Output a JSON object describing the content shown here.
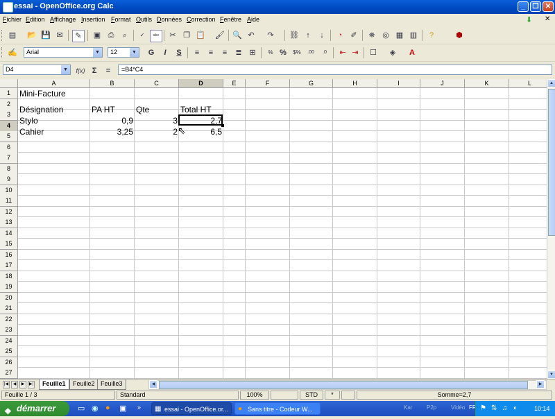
{
  "window": {
    "title": "essai - OpenOffice.org Calc"
  },
  "menu": [
    "Fichier",
    "Edition",
    "Affichage",
    "Insertion",
    "Format",
    "Outils",
    "Données",
    "Correction",
    "Fenêtre",
    "Aide"
  ],
  "format": {
    "font": "Arial",
    "size": "12"
  },
  "formula": {
    "cell_ref": "D4",
    "content": "=B4*C4"
  },
  "columns": [
    "A",
    "B",
    "C",
    "D",
    "E",
    "F",
    "G",
    "H",
    "I",
    "J",
    "K",
    "L"
  ],
  "rows": [
    "1",
    "2",
    "3",
    "4",
    "5",
    "6",
    "7",
    "8",
    "9",
    "10",
    "11",
    "12",
    "13",
    "14",
    "15",
    "16",
    "17",
    "18",
    "19",
    "20",
    "21",
    "22",
    "23",
    "24",
    "25",
    "26",
    "27"
  ],
  "cells": {
    "a1": "Mini-Facture",
    "a3": "Désignation",
    "b3": "PA HT",
    "c3": "Qte",
    "d3": "Total HT",
    "a4": "Stylo",
    "b4": "0,9",
    "c4": "3",
    "d4": "2,7",
    "a5": "Cahier",
    "b5": "3,25",
    "c5": "2",
    "d5": "6,5"
  },
  "sheets": [
    "Feuille1",
    "Feuille2",
    "Feuille3"
  ],
  "status": {
    "sheet": "Feuille 1 / 3",
    "style": "Standard",
    "zoom": "100%",
    "mode": "STD",
    "modified": "*",
    "sum": "Somme=2,7"
  },
  "taskbar": {
    "start": "démarrer",
    "tasks": [
      "essai - OpenOffice.or...",
      "Sans titre - Codeur W..."
    ],
    "tray_items": [
      "Kar",
      "P2p",
      "Vidéo"
    ],
    "lang": "FR",
    "clock": "10:14"
  },
  "colors": {
    "titlebar": "#0A5ED8",
    "taskbar": "#245EDC",
    "selection": "#000000"
  }
}
